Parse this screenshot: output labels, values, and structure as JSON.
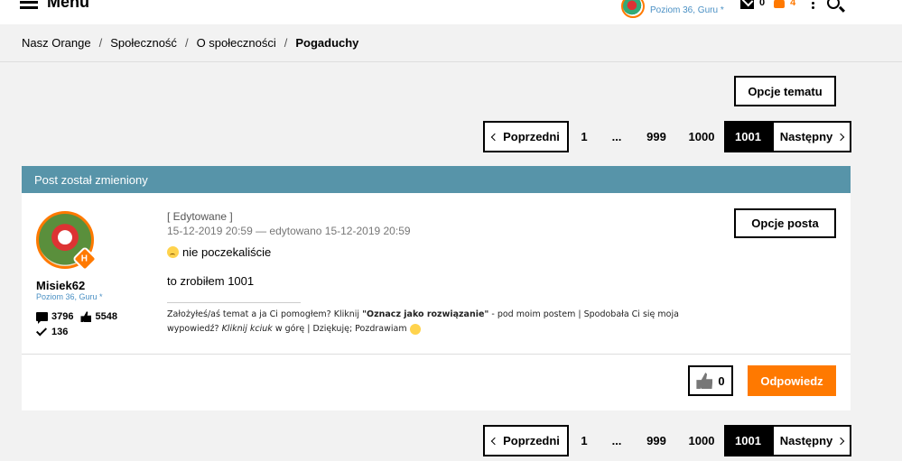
{
  "header": {
    "menu_label": "Menu",
    "user_rank": "Poziom 36, Guru *",
    "messages_count": "0",
    "notifications_count": "4"
  },
  "breadcrumb": {
    "items": [
      "Nasz Orange",
      "Społeczność",
      "O społeczności"
    ],
    "separator": "/",
    "current": "Pogaduchy"
  },
  "topic_options_label": "Opcje tematu",
  "pagination": {
    "prev": "Poprzedni",
    "pages": [
      "1",
      "...",
      "999",
      "1000",
      "1001"
    ],
    "active": "1001",
    "next": "Następny"
  },
  "banner": "Post został zmieniony",
  "post": {
    "author": "Misiek62",
    "rank": "Poziom 36, Guru *",
    "rank_badge": "H",
    "posts_count": "3796",
    "kudos_received": "5548",
    "solutions_count": "136",
    "edited_label": "[ Edytowane ]",
    "meta": "15-12-2019 20:59 — edytowano 15-12-2019 20:59",
    "body_line1": "nie poczekaliście",
    "body_line2": "to zrobiłem 1001",
    "signature": {
      "part1": "Założyłeś/aś temat a ja Ci pomogłem? Kliknij ",
      "bold": "\"Oznacz jako rozwiązanie\"",
      "part2": " - pod moim postem | Spodobała Ci się moja wypowiedź? ",
      "italic": "Kliknij kciuk",
      "part3": " w górę | Dziękuję; Pozdrawiam "
    },
    "options_label": "Opcje posta",
    "kudos_count": "0",
    "reply_label": "Odpowiedz"
  }
}
